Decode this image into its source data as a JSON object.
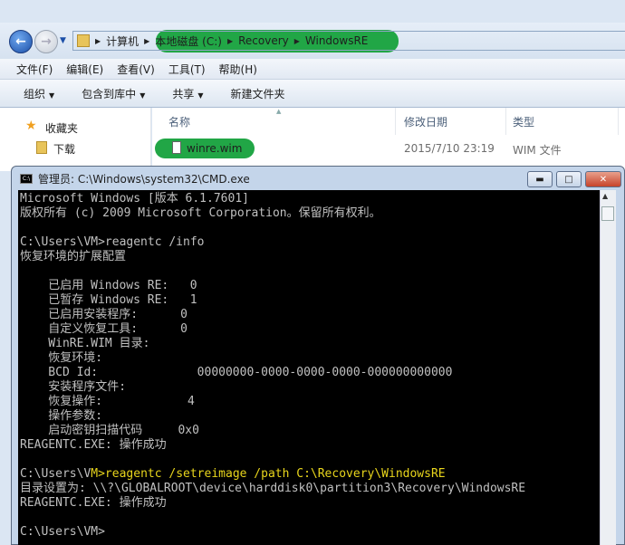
{
  "explorer": {
    "breadcrumb": [
      "计算机",
      "本地磁盘 (C:)",
      "Recovery",
      "WindowsRE"
    ],
    "menu": [
      "文件(F)",
      "编辑(E)",
      "查看(V)",
      "工具(T)",
      "帮助(H)"
    ],
    "toolbar": [
      "组织",
      "包含到库中",
      "共享",
      "新建文件夹"
    ],
    "nav": [
      "收藏夹",
      "下载"
    ],
    "columns": [
      "名称",
      "修改日期",
      "类型"
    ],
    "file": {
      "name": "winre.wim",
      "date": "2015/7/10 23:19",
      "type": "WIM 文件"
    },
    "highlight_color": "#21a646"
  },
  "cmd": {
    "title": "管理员: C:\\Windows\\system32\\CMD.exe",
    "lines": [
      "Microsoft Windows [版本 6.1.7601]",
      "版权所有 (c) 2009 Microsoft Corporation。保留所有权利。",
      "",
      "C:\\Users\\VM>reagentc /info",
      "恢复环境的扩展配置",
      "",
      "    已启用 Windows RE:   0",
      "    已暂存 Windows RE:   1",
      "    已启用安装程序:      0",
      "    自定义恢复工具:      0",
      "    WinRE.WIM 目录:",
      "    恢复环境:",
      "    BCD Id:              00000000-0000-0000-0000-000000000000",
      "    安装程序文件:",
      "    恢复操作:            4",
      "    操作参数:",
      "    启动密钥扫描代码     0x0",
      "REAGENTC.EXE: 操作成功",
      ""
    ],
    "highlight_prefix": "C:\\Users\\V",
    "highlight_cmd": "M>reagentc /setreimage /path C:\\Recovery\\WindowsRE",
    "lines2": [
      "目录设置为: \\\\?\\GLOBALROOT\\device\\harddisk0\\partition3\\Recovery\\WindowsRE",
      "REAGENTC.EXE: 操作成功",
      "",
      "C:\\Users\\VM>"
    ]
  }
}
